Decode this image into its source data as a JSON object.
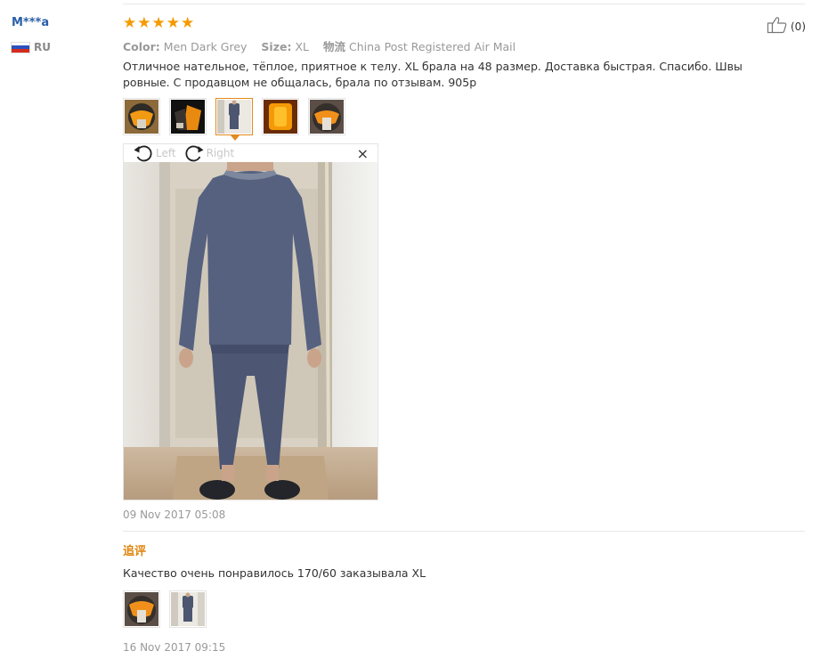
{
  "reviewer": {
    "name": "M***a",
    "country": "RU"
  },
  "rating": {
    "stars": 5,
    "max": 5
  },
  "helpful": {
    "count_label": "(0)"
  },
  "attributes": {
    "color_label": "Color:",
    "color_value": "Men Dark Grey",
    "size_label": "Size:",
    "size_value": "XL",
    "shipping_label": "物流",
    "shipping_value": "China Post Registered Air Mail"
  },
  "review": {
    "text": "Отличное нательное, тёплое, приятное к телу. XL брала на 48 размер. Доставка быстрая. Спасибо. Швы ровные. С продавцом не общалась, брала по отзывам. 905р",
    "thumbnails": [
      "photo-1",
      "photo-2",
      "photo-3",
      "photo-4",
      "photo-5"
    ],
    "selected_index": 2,
    "date": "09 Nov 2017 05:08"
  },
  "viewer": {
    "rotate_left_label": "Left",
    "rotate_right_label": "Right",
    "close_symbol": "×"
  },
  "additional": {
    "heading": "追评",
    "text": "Качество очень понравилось 170/60 заказывала XL",
    "thumbnails": [
      "photo-6",
      "photo-7"
    ],
    "date": "16 Nov 2017 09:15"
  },
  "colors": {
    "accent": "#e38a1c",
    "star": "#f59a00",
    "link": "#2a5ea8",
    "muted": "#999999"
  },
  "icons": [
    "thumbs-up-icon",
    "rotate-left-icon",
    "rotate-right-icon",
    "close-icon",
    "star-icon",
    "russia-flag-icon"
  ]
}
